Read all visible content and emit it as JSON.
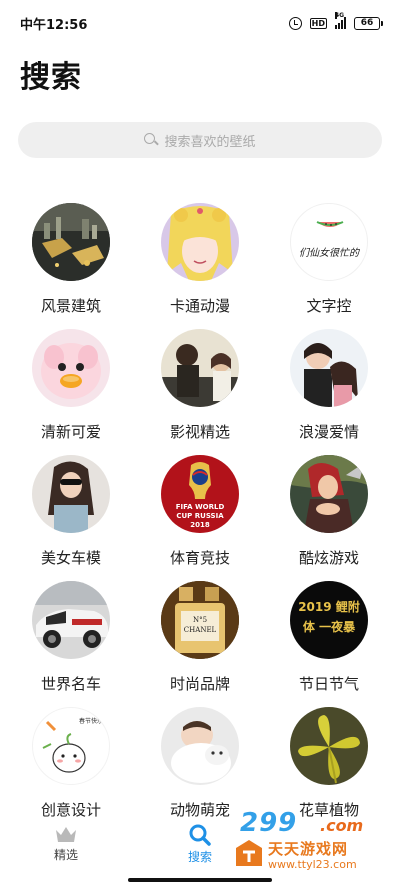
{
  "status_bar": {
    "time": "中午12:56",
    "hd": "HD",
    "network": "4G",
    "battery": "66"
  },
  "page_title": "搜索",
  "search": {
    "placeholder": "搜索喜欢的壁纸"
  },
  "categories": [
    {
      "label": "风景建筑"
    },
    {
      "label": "卡通动漫"
    },
    {
      "label": "文字控",
      "thumb_text": "们仙女很忙的"
    },
    {
      "label": "清新可爱"
    },
    {
      "label": "影视精选"
    },
    {
      "label": "浪漫爱情"
    },
    {
      "label": "美女车模"
    },
    {
      "label": "体育竞技",
      "thumb_text": "FIFA WORLD CUP RUSSIA 2018"
    },
    {
      "label": "酷炫游戏"
    },
    {
      "label": "世界名车"
    },
    {
      "label": "时尚品牌",
      "thumb_text": "N°5 CHANEL"
    },
    {
      "label": "节日节气",
      "thumb_text": "2019 鲤附体 一夜暴"
    },
    {
      "label": "创意设计",
      "thumb_text": "春节快乐"
    },
    {
      "label": "动物萌宠"
    },
    {
      "label": "花草植物"
    }
  ],
  "tab_bar": {
    "tabs": [
      {
        "label": "精选",
        "icon": "crown-icon",
        "active": false
      },
      {
        "label": "搜索",
        "icon": "search-icon",
        "active": true
      }
    ],
    "active_color": "#1e90e6"
  },
  "watermark": {
    "brand_num": "299",
    "brand_com": ".com",
    "brand_cn": "天天游戏网",
    "url": "www.ttyl23.com"
  },
  "colors": {
    "accent": "#1e90e6",
    "search_bg": "#efefef",
    "watermark_orange": "#e8791e"
  }
}
